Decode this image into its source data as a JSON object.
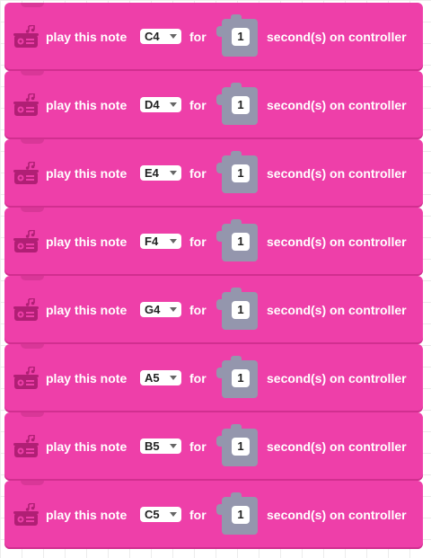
{
  "palette": {
    "block": "#ee3fa9",
    "block_dark": "#d12f90",
    "icon": "#b01f75",
    "socket": "#9496ad",
    "field": "#ffffff",
    "label": "#ffffff"
  },
  "blocks": [
    {
      "label": "play this note",
      "note": "C4",
      "for_label": "for",
      "duration": "1",
      "suffix": "second(s) on controller",
      "icon": "radio-music-icon"
    },
    {
      "label": "play this note",
      "note": "D4",
      "for_label": "for",
      "duration": "1",
      "suffix": "second(s) on controller",
      "icon": "radio-music-icon"
    },
    {
      "label": "play this note",
      "note": "E4",
      "for_label": "for",
      "duration": "1",
      "suffix": "second(s) on controller",
      "icon": "radio-music-icon"
    },
    {
      "label": "play this note",
      "note": "F4",
      "for_label": "for",
      "duration": "1",
      "suffix": "second(s) on controller",
      "icon": "radio-music-icon"
    },
    {
      "label": "play this note",
      "note": "G4",
      "for_label": "for",
      "duration": "1",
      "suffix": "second(s) on controller",
      "icon": "radio-music-icon"
    },
    {
      "label": "play this note",
      "note": "A5",
      "for_label": "for",
      "duration": "1",
      "suffix": "second(s) on controller",
      "icon": "radio-music-icon"
    },
    {
      "label": "play this note",
      "note": "B5",
      "for_label": "for",
      "duration": "1",
      "suffix": "second(s) on controller",
      "icon": "radio-music-icon"
    },
    {
      "label": "play this note",
      "note": "C5",
      "for_label": "for",
      "duration": "1",
      "suffix": "second(s) on controller",
      "icon": "radio-music-icon"
    }
  ]
}
